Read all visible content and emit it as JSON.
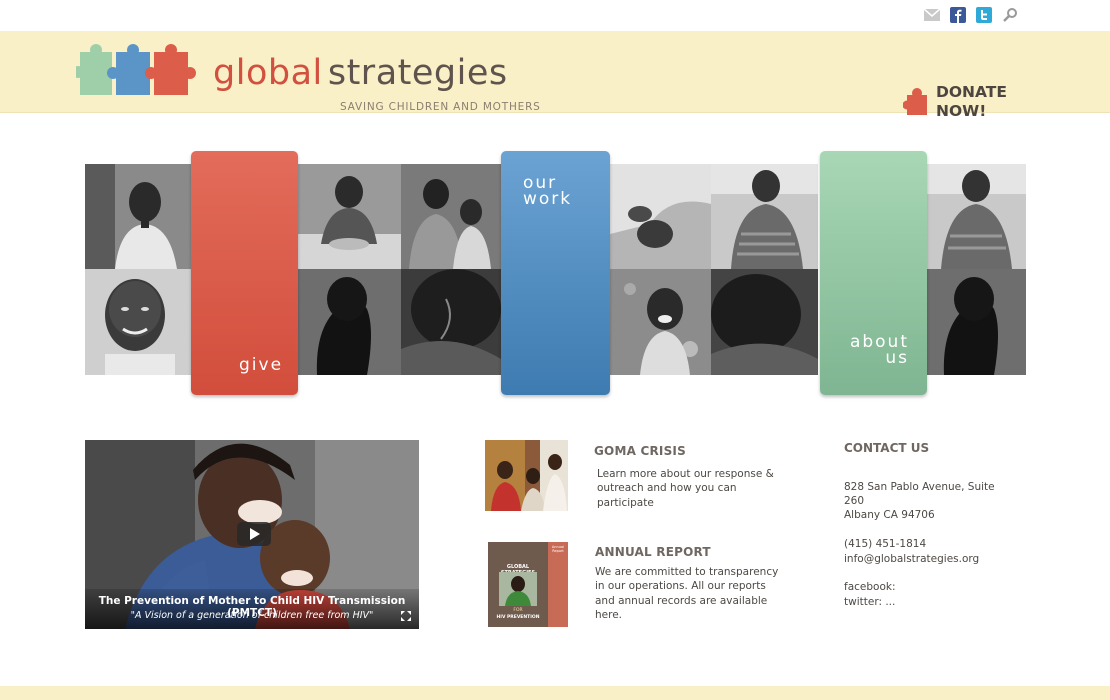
{
  "header": {
    "brand_primary": "global",
    "brand_secondary": "strategies",
    "tagline": "SAVING CHILDREN AND MOTHERS",
    "donate_line1": "DONATE",
    "donate_line2": "NOW!"
  },
  "top_icons": [
    "email-icon",
    "facebook-icon",
    "twitter-icon",
    "search-icon"
  ],
  "tiles": {
    "give": "give",
    "our_work_line1": "our",
    "our_work_line2": "work",
    "about_us_line1": "about",
    "about_us_line2": "us"
  },
  "video": {
    "caption_title": "The Prevention of Mother to Child HIV Transmission (PMTCT)",
    "caption_quote": "\"A Vision of a generation of children free from HIV\""
  },
  "news": [
    {
      "title": "GOMA CRISIS",
      "body": "Learn more about our response & outreach and how you can participate"
    },
    {
      "title": "ANNUAL REPORT",
      "body": "We are committed to transparency in our operations. All our reports and annual records are available here."
    }
  ],
  "report_cover": {
    "title": "GLOBAL STRATEGIES",
    "for": "FOR",
    "subtitle": "HIV PREVENTION",
    "side": "Annual Report"
  },
  "contact": {
    "heading": "CONTACT US",
    "address1": "828 San Pablo Avenue, Suite",
    "address2": "260",
    "address3": "Albany CA 94706",
    "phone": "(415) 451-1814",
    "email": "info@globalstrategies.org",
    "facebook": "facebook:",
    "twitter": "twitter: ..."
  },
  "colors": {
    "header_bg": "#faf0c8",
    "give": "#dd5b4a",
    "our_work": "#4f8cc0",
    "about_us": "#8dc49f",
    "brand_red": "#d1503f"
  }
}
